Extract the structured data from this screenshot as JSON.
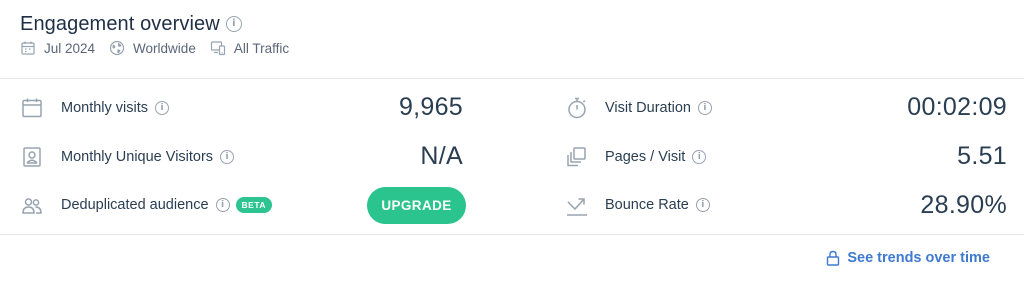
{
  "header": {
    "title": "Engagement overview",
    "filters": [
      {
        "icon": "calendar-icon",
        "label": "Jul 2024"
      },
      {
        "icon": "globe-icon",
        "label": "Worldwide"
      },
      {
        "icon": "devices-icon",
        "label": "All Traffic"
      }
    ]
  },
  "metrics_left": [
    {
      "icon": "calendar-icon",
      "label": "Monthly visits",
      "value": "9,965"
    },
    {
      "icon": "id-card-icon",
      "label": "Monthly Unique Visitors",
      "value": "N/A"
    },
    {
      "icon": "people-icon",
      "label": "Deduplicated audience",
      "badge": "BETA",
      "button_label": "UPGRADE"
    }
  ],
  "metrics_right": [
    {
      "icon": "stopwatch-icon",
      "label": "Visit Duration",
      "value": "00:02:09"
    },
    {
      "icon": "pages-icon",
      "label": "Pages / Visit",
      "value": "5.51"
    },
    {
      "icon": "bounce-arrow-icon",
      "label": "Bounce Rate",
      "value": "28.90%"
    }
  ],
  "footer": {
    "link_label": "See trends over time",
    "link_icon": "lock-icon"
  },
  "colors": {
    "accent_green": "#2bc48f",
    "link_blue": "#3f7ad1",
    "text_dark": "#2a3e52",
    "icon_gray": "#98a3b0"
  }
}
